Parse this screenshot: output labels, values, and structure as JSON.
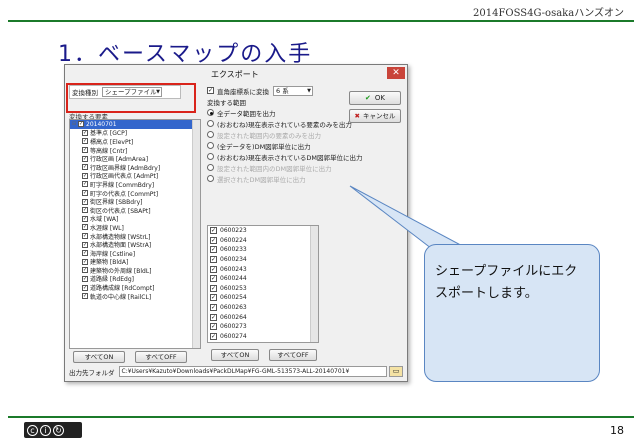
{
  "header": {
    "event": "2014FOSS4G-osakaハンズオン"
  },
  "slide": {
    "title": "1．ベースマップの入手",
    "page_number": "18"
  },
  "license": {
    "icons": [
      "cc",
      "by",
      "sa"
    ]
  },
  "dialog": {
    "title": "エクスポート",
    "close_label": "✕",
    "type_label": "変換種別",
    "type_value": "シェープファイル",
    "layer_header": "変換する要素",
    "layers": [
      {
        "label": "20140701",
        "checked": true,
        "selected": true,
        "child": false
      },
      {
        "label": "基準点 [GCP]",
        "checked": true,
        "child": true
      },
      {
        "label": "標高点 [ElevPt]",
        "checked": true,
        "child": true
      },
      {
        "label": "等高線 [Cntr]",
        "checked": true,
        "child": true
      },
      {
        "label": "行政区画 [AdmArea]",
        "checked": true,
        "child": true
      },
      {
        "label": "行政区画界線 [AdmBdry]",
        "checked": true,
        "child": true
      },
      {
        "label": "行政区画代表点 [AdmPt]",
        "checked": true,
        "child": true
      },
      {
        "label": "町字界線 [CommBdry]",
        "checked": true,
        "child": true
      },
      {
        "label": "町字の代表点 [CommPt]",
        "checked": true,
        "child": true
      },
      {
        "label": "街区界線 [SBBdry]",
        "checked": true,
        "child": true
      },
      {
        "label": "街区の代表点 [SBAPt]",
        "checked": true,
        "child": true
      },
      {
        "label": "水域 [WA]",
        "checked": true,
        "child": true
      },
      {
        "label": "水涯線 [WL]",
        "checked": true,
        "child": true
      },
      {
        "label": "水部構造物線 [WStrL]",
        "checked": true,
        "child": true
      },
      {
        "label": "水部構造物面 [WStrA]",
        "checked": true,
        "child": true
      },
      {
        "label": "海岸線 [Cstline]",
        "checked": true,
        "child": true
      },
      {
        "label": "建築物 [BldA]",
        "checked": true,
        "child": true
      },
      {
        "label": "建築物の外周線 [BldL]",
        "checked": true,
        "child": true
      },
      {
        "label": "道路縁 [RdEdg]",
        "checked": true,
        "child": true
      },
      {
        "label": "道路構成線 [RdCompt]",
        "checked": true,
        "child": true
      },
      {
        "label": "軌道の中心線 [RailCL]",
        "checked": true,
        "child": true
      }
    ],
    "select_all": "すべてON",
    "deselect_all": "すべてOFF",
    "coord_label": "直角座標系に変換",
    "coord_value": "6 系",
    "range_header": "変換する範囲",
    "options": [
      {
        "label": "全データ範囲を出力",
        "on": true,
        "disabled": false
      },
      {
        "label": "(おおむね)現在表示されている要素のみを出力",
        "on": false,
        "disabled": false
      },
      {
        "label": "設定された範囲内の要素のみを出力",
        "on": false,
        "disabled": true
      },
      {
        "label": "(全データを)DM図郭単位に出力",
        "on": false,
        "disabled": false
      },
      {
        "label": "(おおむね)現在表示されているDM図郭単位に出力",
        "on": false,
        "disabled": false
      },
      {
        "label": "設定された範囲内のDM図郭単位に出力",
        "on": false,
        "disabled": true
      },
      {
        "label": "選択されたDM図郭単位に出力",
        "on": false,
        "disabled": true
      }
    ],
    "meshes": [
      "0600223",
      "0600224",
      "0600233",
      "0600234",
      "0600243",
      "0600244",
      "0600253",
      "0600254",
      "0600263",
      "0600264",
      "0600273",
      "0600274"
    ],
    "ok_label": "OK",
    "cancel_label": "キャンセル",
    "outdir_label": "出力先フォルダ",
    "outdir_value": "C:¥Users¥Kazuto¥Downloads¥PackDLMap¥FG-GML-513573-ALL-20140701¥"
  },
  "callout": {
    "text": "シェープファイルにエクスポートします。"
  },
  "colors": {
    "accent_line": "#1b7a2a",
    "title": "#1a1a8a",
    "highlight": "#d9241b",
    "callout_fill": "#d7e5f5"
  }
}
